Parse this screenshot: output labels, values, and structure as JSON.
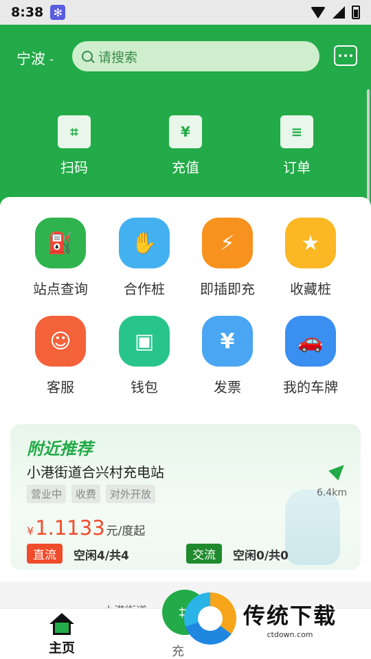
{
  "status_bar": {
    "time": "8:38"
  },
  "header": {
    "city": "宁波",
    "search_placeholder": "请搜索",
    "quick_actions": [
      {
        "label": "扫码",
        "icon": "scan-icon"
      },
      {
        "label": "充值",
        "icon": "recharge-icon",
        "glyph": "¥"
      },
      {
        "label": "订单",
        "icon": "order-icon"
      }
    ]
  },
  "grid": [
    {
      "label": "站点查询",
      "icon": "charging-station-icon",
      "color": "#2fb34f",
      "glyph": "⛽"
    },
    {
      "label": "合作桩",
      "icon": "handshake-icon",
      "color": "#43b1f0",
      "glyph": "✋"
    },
    {
      "label": "即插即充",
      "icon": "lightning-icon",
      "color": "#f8921e",
      "glyph": "⚡"
    },
    {
      "label": "收藏桩",
      "icon": "star-icon",
      "color": "#fbb724",
      "glyph": "★"
    },
    {
      "label": "客服",
      "icon": "customer-service-icon",
      "color": "#f4623a",
      "glyph": "☺"
    },
    {
      "label": "钱包",
      "icon": "wallet-icon",
      "color": "#27c48b",
      "glyph": "▣"
    },
    {
      "label": "发票",
      "icon": "invoice-icon",
      "color": "#4aa6f2",
      "glyph": "¥"
    },
    {
      "label": "我的车牌",
      "icon": "car-icon",
      "color": "#3a8ff0",
      "glyph": "🚗"
    }
  ],
  "nearby": {
    "title": "附近推荐",
    "station_name": "小港街道合兴村充电站",
    "tags": [
      "营业中",
      "收费",
      "对外开放"
    ],
    "distance": "6.4km",
    "price_currency": "¥",
    "price_value": "1.1133",
    "price_unit": "元/度起",
    "dc": {
      "badge": "直流",
      "text": "空闲4/共4"
    },
    "ac": {
      "badge": "交流",
      "text": "空闲0/共0"
    }
  },
  "partial_text": "小港街道",
  "bottom_nav": {
    "home_label": "主页",
    "charge_label": "充"
  },
  "watermark": {
    "main": "传统下载",
    "sub": "ctdown.com"
  }
}
